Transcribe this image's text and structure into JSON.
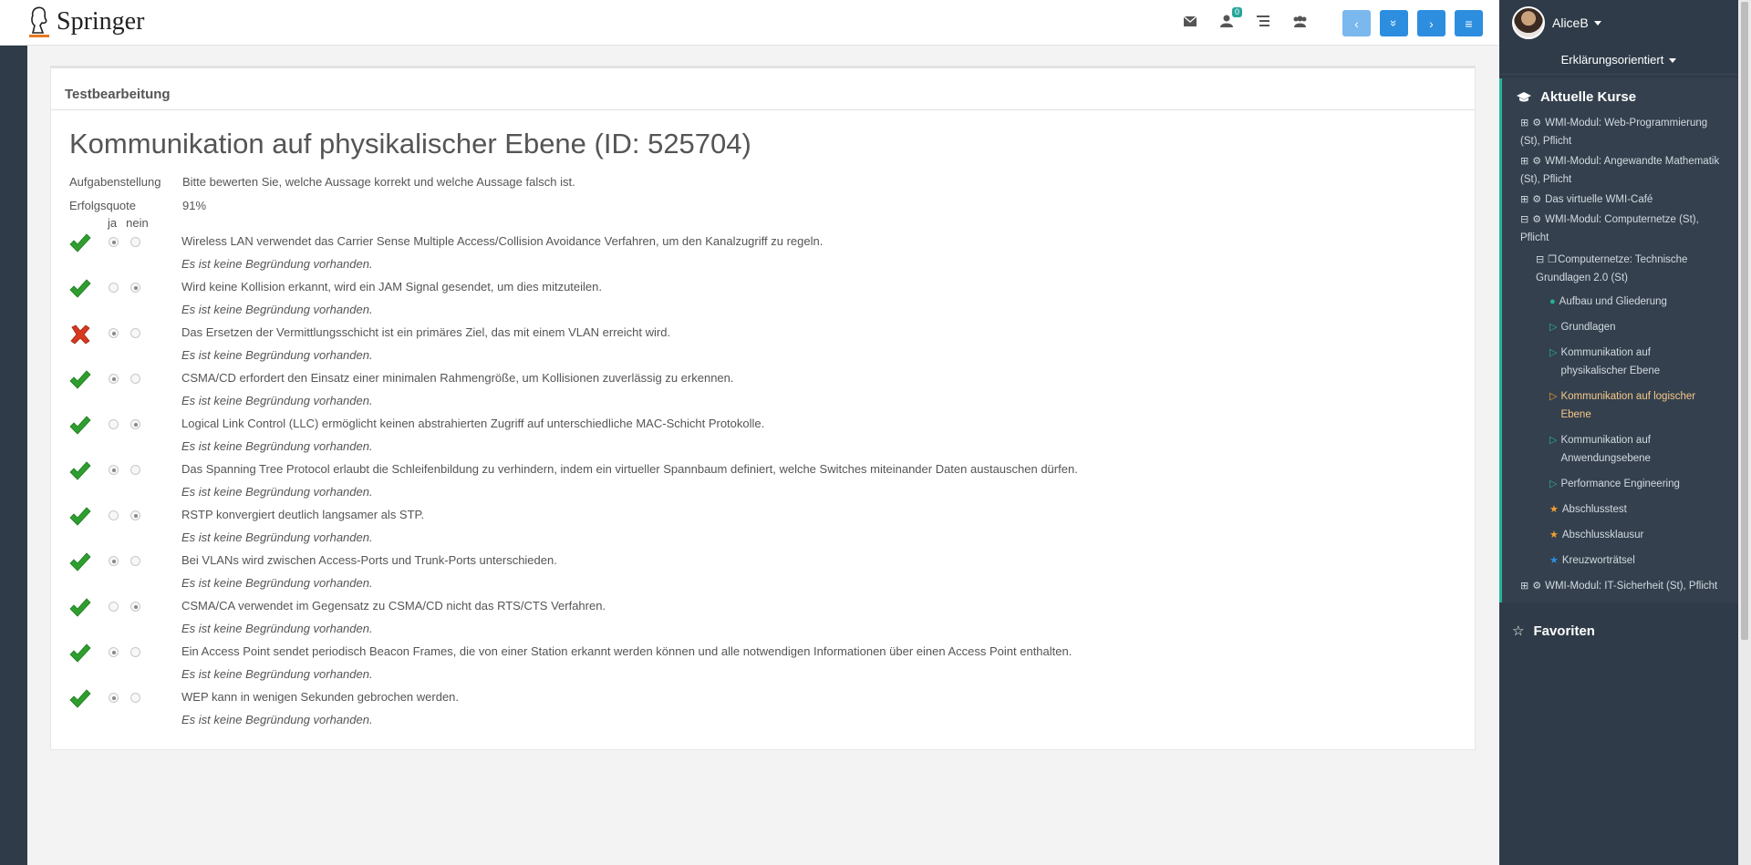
{
  "header": {
    "logo_text": "Springer",
    "mail_icon": "envelope-icon",
    "notifications_badge": "0",
    "list_icon": "list-icon",
    "group_icon": "users-icon",
    "nav_buttons": [
      "‹",
      "»",
      "›",
      "≡"
    ]
  },
  "sidebar": {
    "user_name": "AliceB",
    "mode_label": "Erklärungsorientiert",
    "courses_heading": "Aktuelle Kurse",
    "favorites_heading": "Favoriten",
    "items": [
      {
        "label": "WMI-Modul: Web-Programmierung (St), Pflicht"
      },
      {
        "label": "WMI-Modul: Angewandte Mathematik (St), Pflicht"
      },
      {
        "label": "Das virtuelle WMI-Café"
      },
      {
        "label": "WMI-Modul: Computernetze (St), Pflicht"
      },
      {
        "label": "Computernetze: Technische Grundlagen 2.0 (St)"
      },
      {
        "label": "Aufbau und Gliederung"
      },
      {
        "label": "Grundlagen"
      },
      {
        "label": "Kommunikation auf physikalischer Ebene"
      },
      {
        "label": "Kommunikation auf logischer Ebene"
      },
      {
        "label": "Kommunikation auf Anwendungsebene"
      },
      {
        "label": "Performance Engineering"
      },
      {
        "label": "Abschlusstest"
      },
      {
        "label": "Abschlussklausur"
      },
      {
        "label": "Kreuzworträtsel"
      },
      {
        "label": "WMI-Modul: IT-Sicherheit (St), Pflicht"
      }
    ]
  },
  "main": {
    "panel_title": "Testbearbeitung",
    "task_title": "Kommunikation auf physikalischer Ebene (ID: 525704)",
    "task_label": "Aufgabenstellung",
    "task_text": "Bitte bewerten Sie, welche Aussage korrekt und welche Aussage falsch ist.",
    "quota_label": "Erfolgsquote",
    "quota_value": "91%",
    "col_yes": "ja",
    "col_no": "nein",
    "questions": [
      {
        "correct": true,
        "answer": "ja",
        "text": "Wireless LAN verwendet das Carrier Sense Multiple Access/Collision Avoidance Verfahren, um den Kanalzugriff zu regeln.",
        "reason": "Es ist keine Begründung vorhanden."
      },
      {
        "correct": true,
        "answer": "nein",
        "text": "Wird keine Kollision erkannt, wird ein JAM Signal gesendet, um dies mitzuteilen.",
        "reason": "Es ist keine Begründung vorhanden."
      },
      {
        "correct": false,
        "answer": "ja",
        "text": "Das Ersetzen der Vermittlungsschicht ist ein primäres Ziel, das mit einem VLAN erreicht wird.",
        "reason": "Es ist keine Begründung vorhanden."
      },
      {
        "correct": true,
        "answer": "ja",
        "text": "CSMA/CD erfordert den Einsatz einer minimalen Rahmengröße, um Kollisionen zuverlässig zu erkennen.",
        "reason": "Es ist keine Begründung vorhanden."
      },
      {
        "correct": true,
        "answer": "nein",
        "text": "Logical Link Control (LLC) ermöglicht keinen abstrahierten Zugriff auf unterschiedliche MAC-Schicht Protokolle.",
        "reason": "Es ist keine Begründung vorhanden."
      },
      {
        "correct": true,
        "answer": "ja",
        "text": "Das Spanning Tree Protocol erlaubt die Schleifenbildung zu verhindern, indem ein virtueller Spannbaum definiert, welche Switches miteinander Daten austauschen dürfen.",
        "reason": "Es ist keine Begründung vorhanden."
      },
      {
        "correct": true,
        "answer": "nein",
        "text": "RSTP konvergiert deutlich langsamer als STP.",
        "reason": "Es ist keine Begründung vorhanden."
      },
      {
        "correct": true,
        "answer": "ja",
        "text": "Bei VLANs wird zwischen Access-Ports und Trunk-Ports unterschieden.",
        "reason": "Es ist keine Begründung vorhanden."
      },
      {
        "correct": true,
        "answer": "nein",
        "text": "CSMA/CA verwendet im Gegensatz zu CSMA/CD nicht das RTS/CTS Verfahren.",
        "reason": "Es ist keine Begründung vorhanden."
      },
      {
        "correct": true,
        "answer": "ja",
        "text": "Ein Access Point sendet periodisch Beacon Frames, die von einer Station erkannt werden können und alle notwendigen Informationen über einen Access Point enthalten.",
        "reason": "Es ist keine Begründung vorhanden."
      },
      {
        "correct": true,
        "answer": "ja",
        "text": "WEP kann in wenigen Sekunden gebrochen werden.",
        "reason": "Es ist keine Begründung vorhanden."
      }
    ]
  },
  "colors": {
    "sidebar_bg": "#2f3b48",
    "accent_blue": "#2d8ee0",
    "accent_green": "#26b39a",
    "check_green": "#2e9e2e",
    "cross_red": "#d9381e"
  }
}
